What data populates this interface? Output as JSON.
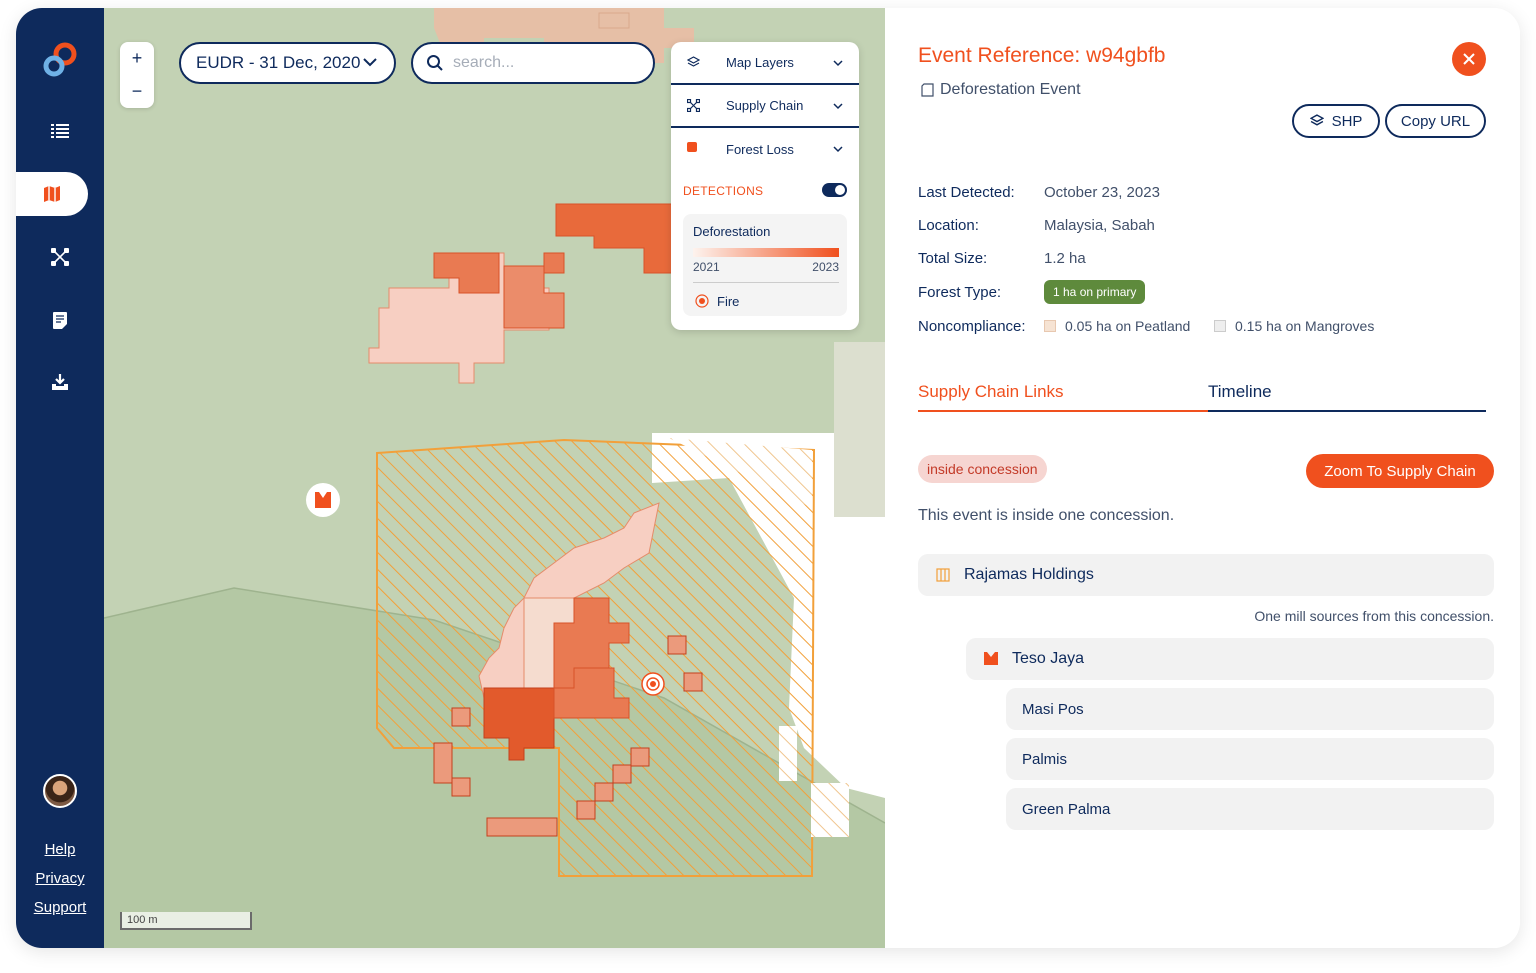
{
  "sidebar": {
    "links": {
      "help": "Help",
      "privacy": "Privacy",
      "support": "Support"
    },
    "nav": [
      "list-icon",
      "map-icon",
      "supply-chain-icon",
      "report-icon",
      "download-icon"
    ],
    "active": "map-icon"
  },
  "map": {
    "zoom_in": "+",
    "zoom_out": "−",
    "date_filter": "EUDR - 31 Dec, 2020",
    "search_placeholder": "search...",
    "layers": {
      "map_layers": "Map Layers",
      "supply_chain": "Supply Chain",
      "forest_loss": "Forest Loss",
      "detections_label": "DETECTIONS",
      "detections_on": true,
      "legend": {
        "deforestation_label": "Deforestation",
        "year_start": "2021",
        "year_end": "2023",
        "fire_label": "Fire"
      }
    },
    "scale_label": "100 m"
  },
  "event": {
    "title": "Event Reference: w94gbfb",
    "type": "Deforestation Event",
    "shp_button": "SHP",
    "copy_url_button": "Copy URL",
    "details": {
      "last_detected_label": "Last Detected:",
      "last_detected": "October 23, 2023",
      "location_label": "Location:",
      "location": "Malaysia, Sabah",
      "total_size_label": "Total Size:",
      "total_size": "1.2 ha",
      "forest_type_label": "Forest Type:",
      "forest_type": "1 ha on primary",
      "noncompliance_label": "Noncompliance:",
      "noncompliance": [
        "0.05 ha on Peatland",
        "0.15 ha on Mangroves"
      ]
    },
    "tabs": {
      "supply_chain_links": "Supply Chain Links",
      "timeline": "Timeline",
      "active": "supply_chain_links"
    },
    "concession_status": "inside concession",
    "zoom_button": "Zoom To Supply Chain",
    "description": "This event is inside one concession.",
    "concession": {
      "name": "Rajamas Holdings",
      "note": "One mill sources from this concession.",
      "mill": "Teso Jaya",
      "suppliers": [
        "Masi Pos",
        "Palmis",
        "Green Palma"
      ]
    }
  },
  "colors": {
    "navy": "#0e2a5c",
    "accent": "#f0501e",
    "map_green": "#c3d2b4",
    "forest_badge": "#5e8a3c"
  }
}
